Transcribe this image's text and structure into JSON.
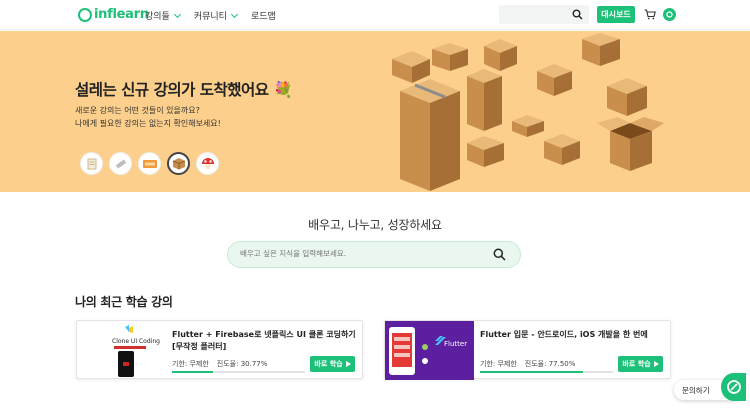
{
  "header": {
    "logo": "inflearn",
    "nav": [
      {
        "label": "강의들",
        "has_dropdown": true
      },
      {
        "label": "커뮤니티",
        "has_dropdown": true
      },
      {
        "label": "로드맵",
        "has_dropdown": false
      }
    ],
    "search_placeholder": "",
    "dashboard_label": "대시보드",
    "icons": [
      "search-icon",
      "cart-icon",
      "user-icon"
    ]
  },
  "hero": {
    "title": "설레는 신규 강의가 도착했어요 💐",
    "subtitle_line1": "새로운 강의는 어떤 것들이 있을까요?",
    "subtitle_line2": "나에게 필요한 강의는 없는지 확인해보세요!",
    "thumbnails": [
      "thumb-1",
      "thumb-2",
      "thumb-3",
      "thumb-4",
      "thumb-5"
    ],
    "active_thumbnail": 3,
    "background": "#fcd08c"
  },
  "slogan": "배우고, 나누고, 성장하세요",
  "search": {
    "placeholder": "배우고 싶은 지식을 입력해보세요."
  },
  "recent": {
    "title": "나의 최근 학습 강의",
    "courses": [
      {
        "title": "Flutter + Firebase로 넷플릭스 UI 클론 코딩하기 [무작정 플러터]",
        "thumb_text": "Clone UI Coding",
        "period": "기한: 무제한",
        "progress_label": "진도율: 30.77%",
        "progress": 30.77,
        "button": "바로 학습"
      },
      {
        "title": "Flutter 입문 - 안드로이드, iOS 개발을 한 번에",
        "thumb_text": "Flutter",
        "period": "기한: 무제한",
        "progress_label": "진도율: 77.50%",
        "progress": 77.5,
        "button": "바로 학습"
      }
    ]
  },
  "help": {
    "label": "문의하기"
  },
  "colors": {
    "brand": "#1dc078",
    "hero_bg": "#fcd08c"
  }
}
